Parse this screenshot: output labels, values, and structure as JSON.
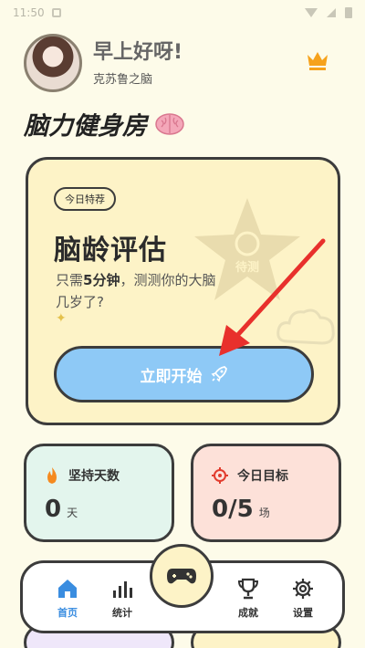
{
  "status": {
    "time": "11:50"
  },
  "header": {
    "greeting": "早上好呀!",
    "username": "克苏鲁之脑"
  },
  "page_title": "脑力健身房",
  "hero": {
    "tag": "今日特荐",
    "title": "脑龄评估",
    "desc_prefix": "只需",
    "desc_highlight": "5分钟",
    "desc_suffix": "，测测你的大脑几岁了?",
    "badge_label": "待测",
    "start_label": "立即开始"
  },
  "stats": {
    "streak_label": "坚持天数",
    "streak_value": "0",
    "streak_unit": "天",
    "goal_label": "今日目标",
    "goal_value": "0/5",
    "goal_unit": "场"
  },
  "nav": {
    "home": "首页",
    "stats": "统计",
    "achievements": "成就",
    "settings": "设置"
  },
  "colors": {
    "accent": "#3a8de0",
    "hero_bg": "#fdf3c7",
    "button": "#8ec9f6",
    "streak_bg": "#e3f5ed",
    "goal_bg": "#fde1d9",
    "annotation_arrow": "#e8302c"
  }
}
